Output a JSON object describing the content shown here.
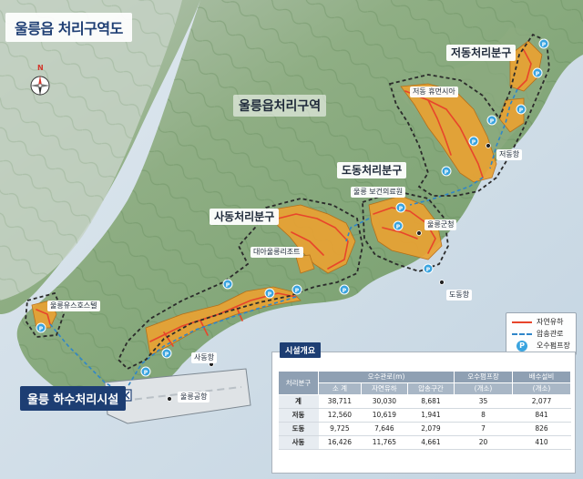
{
  "title": "울릉읍 처리구역도",
  "zone_label": "울릉읍처리구역",
  "districts": {
    "jeodong": "저동처리분구",
    "dodong": "도동처리분구",
    "sadong": "사동처리분구"
  },
  "places": {
    "jeodong_park": "저동 휴먼시아",
    "jeodong_port": "저동항",
    "health_center": "울릉 보건의료원",
    "county_office": "울릉군청",
    "dodong_port": "도동항",
    "daea_resort": "대아울릉리조트",
    "youth_hostel": "울릉유스호스텔",
    "sadong_port": "사동항",
    "airport": "울릉공항"
  },
  "plant_label": "울릉 하수처리시설",
  "compass_letter": "N",
  "legend": {
    "natural": "자연유하",
    "pressure": "압송관로",
    "pump": "오수펌프장",
    "pump_symbol": "P"
  },
  "colors": {
    "natural_flow": "#e8452b",
    "pressure_main": "#2f86c9",
    "catchment": "#e9a233",
    "boundary": "#2b2b2b",
    "sea": "#c9d9e6",
    "title_blue": "#1d3e73"
  },
  "facility_summary": {
    "title": "시설개요",
    "headers": {
      "district": "처리분구",
      "sewer": "오수관로(m)",
      "pump_station": "오수펌프장",
      "pump_unit": "(개소)",
      "drainage": "배수설비",
      "drainage_unit": "(개소)",
      "subtotal": "소 계",
      "natural": "자연유하",
      "pressure": "압송구간"
    },
    "rows": [
      {
        "name": "계",
        "subtotal": "38,711",
        "natural": "30,030",
        "pressure": "8,681",
        "pump": "35",
        "drainage": "2,077"
      },
      {
        "name": "저동",
        "subtotal": "12,560",
        "natural": "10,619",
        "pressure": "1,941",
        "pump": "8",
        "drainage": "841"
      },
      {
        "name": "도동",
        "subtotal": "9,725",
        "natural": "7,646",
        "pressure": "2,079",
        "pump": "7",
        "drainage": "826"
      },
      {
        "name": "사동",
        "subtotal": "16,426",
        "natural": "11,765",
        "pressure": "4,661",
        "pump": "20",
        "drainage": "410"
      }
    ]
  }
}
